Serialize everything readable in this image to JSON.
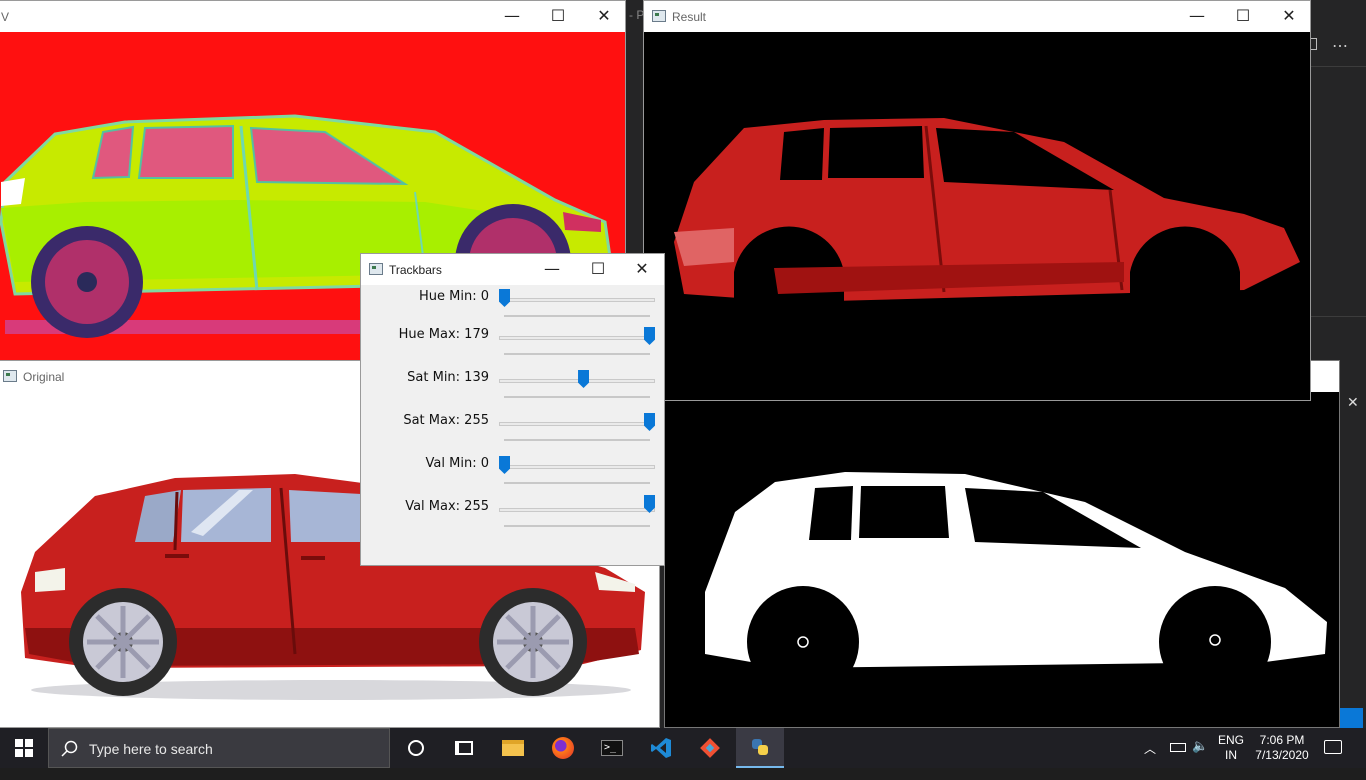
{
  "windows": {
    "hsv": {
      "title": "V"
    },
    "original": {
      "title": "Original"
    },
    "result": {
      "title": "Result"
    },
    "mask": {
      "title": ""
    },
    "trackbars": {
      "title": "Trackbars"
    }
  },
  "window_buttons": {
    "minimize": "—",
    "maximize": "☐",
    "close": "✕"
  },
  "trackbars": [
    {
      "label": "Hue Min: 0",
      "value": 0,
      "max": 179
    },
    {
      "label": "Hue Max: 179",
      "value": 179,
      "max": 179
    },
    {
      "label": "Sat Min: 139",
      "value": 139,
      "max": 255
    },
    {
      "label": "Sat Max: 255",
      "value": 255,
      "max": 255
    },
    {
      "label": "Val Min: 0",
      "value": 0,
      "max": 255
    },
    {
      "label": "Val Max: 255",
      "value": 255,
      "max": 255
    }
  ],
  "background_editor": {
    "title_fragment": "- P"
  },
  "taskbar": {
    "search_placeholder": "Type here to search",
    "apps": [
      "task-view",
      "file-explorer",
      "firefox",
      "terminal",
      "vscode",
      "git",
      "python"
    ],
    "tray": {
      "lang_top": "ENG",
      "lang_bottom": "IN",
      "time": "7:06 PM",
      "date": "7/13/2020"
    }
  },
  "colors": {
    "hsv_bg": "#ff0000",
    "hsv_car": "#c7ea00",
    "car_red": "#c8201e",
    "accent": "#0a78d7",
    "taskbar": "#1f1f24"
  }
}
